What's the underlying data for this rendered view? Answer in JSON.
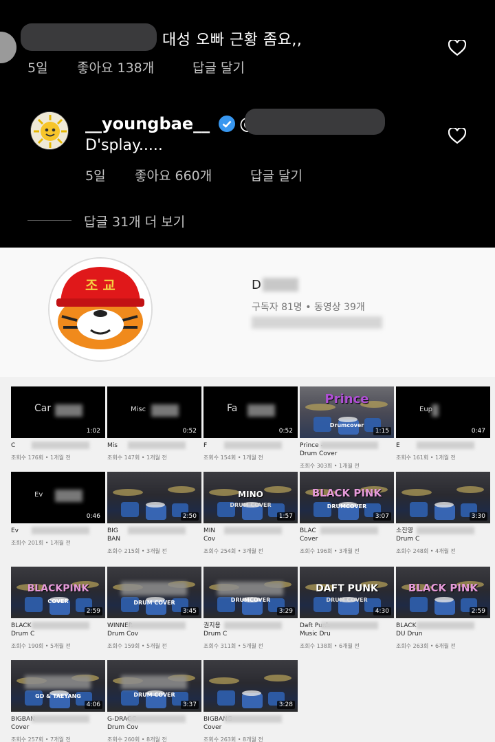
{
  "instagram": {
    "comment1": {
      "text": "대성 오빠 근황 좀요,,",
      "time": "5일",
      "likes": "좋아요 138개",
      "reply": "답글 달기"
    },
    "reply": {
      "username": "__youngbae__",
      "mention_prefix": "@",
      "text": "D'splay.....",
      "time": "5일",
      "likes": "좋아요 660개",
      "reply": "답글 달기"
    },
    "more_replies": "답글 31개 더 보기"
  },
  "youtube": {
    "channel_name": "D",
    "stats": "구독자 81명 • 동영상 39개",
    "avatar_text": "조 교",
    "videos": [
      {
        "thumb_text": "Car",
        "duration": "1:02",
        "title": "C",
        "meta": "조회수 176회 • 1개월 전"
      },
      {
        "thumb_text": "Misc",
        "duration": "0:52",
        "title": "Mis",
        "meta": "조회수 147회 • 1개월 전"
      },
      {
        "thumb_text": "Fa",
        "duration": "0:52",
        "title": "F",
        "meta": "조회수 154회 • 1개월 전"
      },
      {
        "thumb_text": "Prince",
        "thumb_sub": "Drumcover",
        "duration": "1:15",
        "title": "Prince -",
        "title2": "Drum Cover",
        "meta": "조회수 303회 • 1개월 전"
      },
      {
        "thumb_text": "Eup",
        "duration": "0:47",
        "title": "E",
        "meta": "조회수 161회 • 1개월 전"
      },
      {
        "thumb_text": "Ev",
        "duration": "0:46",
        "title": "Ev",
        "meta": "조회수 201회 • 1개월 전"
      },
      {
        "thumb_text": "",
        "duration": "2:50",
        "title": "BIG",
        "title2": "BAN",
        "meta": "조회수 215회 • 3개월 전"
      },
      {
        "thumb_text": "MINO",
        "thumb_sub": "DRUM COVER",
        "duration": "1:57",
        "title": "MIN",
        "title2": "Cov",
        "meta": "조회수 254회 • 3개월 전"
      },
      {
        "thumb_text": "BLACK PINK",
        "thumb_sub": "DRUMCOVER",
        "duration": "3:07",
        "title": "BLAC",
        "title2": "Cover",
        "meta": "조회수 196회 • 3개월 전"
      },
      {
        "thumb_text": "",
        "duration": "3:30",
        "title": "소진영",
        "title2": "Drum C",
        "meta": "조회수 248회 • 4개월 전"
      },
      {
        "thumb_text": "BLACKPINK",
        "thumb_sub": "COVER",
        "duration": "2:59",
        "title": "BLACK",
        "title2": "Drum C",
        "meta": "조회수 190회 • 5개월 전"
      },
      {
        "thumb_text": "",
        "thumb_sub": "DRUM COVER",
        "duration": "3:45",
        "title": "WINNER -",
        "title2": "Drum Cov",
        "meta": "조회수 159회 • 5개월 전"
      },
      {
        "thumb_text": "",
        "thumb_sub": "DRUMCOVER",
        "duration": "3:29",
        "title": "권지용",
        "title2": "Drum C",
        "meta": "조회수 311회 • 5개월 전"
      },
      {
        "thumb_text": "DAFT PUNK",
        "thumb_sub": "DRUM COVER",
        "duration": "4:30",
        "title": "Daft Punk",
        "title2": "Music Dru",
        "meta": "조회수 138회 • 6개월 전"
      },
      {
        "thumb_text": "BLACK PINK",
        "duration": "2:59",
        "title": "BLACK",
        "title2": "DU Drun",
        "meta": "조회수 263회 • 6개월 전"
      },
      {
        "thumb_text": "",
        "thumb_sub": "GD & TAEYANG",
        "duration": "4:06",
        "title": "BIGBAN",
        "title2": "Cover",
        "meta": "조회수 257회 • 7개월 전"
      },
      {
        "thumb_text": "",
        "thumb_sub": "DRUM COVER",
        "duration": "3:37",
        "title": "G-DRAGC",
        "title2": "Drum Cov",
        "meta": "조회수 260회 • 8개월 전"
      },
      {
        "thumb_text": "",
        "duration": "3:28",
        "title": "BIGBANG -",
        "title2": "Cover",
        "meta": "조회수 263회 • 8개월 전"
      }
    ]
  },
  "colors": {
    "ig_bg": "#000000",
    "redaction": "#3a3a3c",
    "verified": "#3897f0",
    "yt_bg": "#f1f1f1",
    "overlay_purple": "#b04fd6",
    "overlay_pink": "#e59ad9"
  }
}
